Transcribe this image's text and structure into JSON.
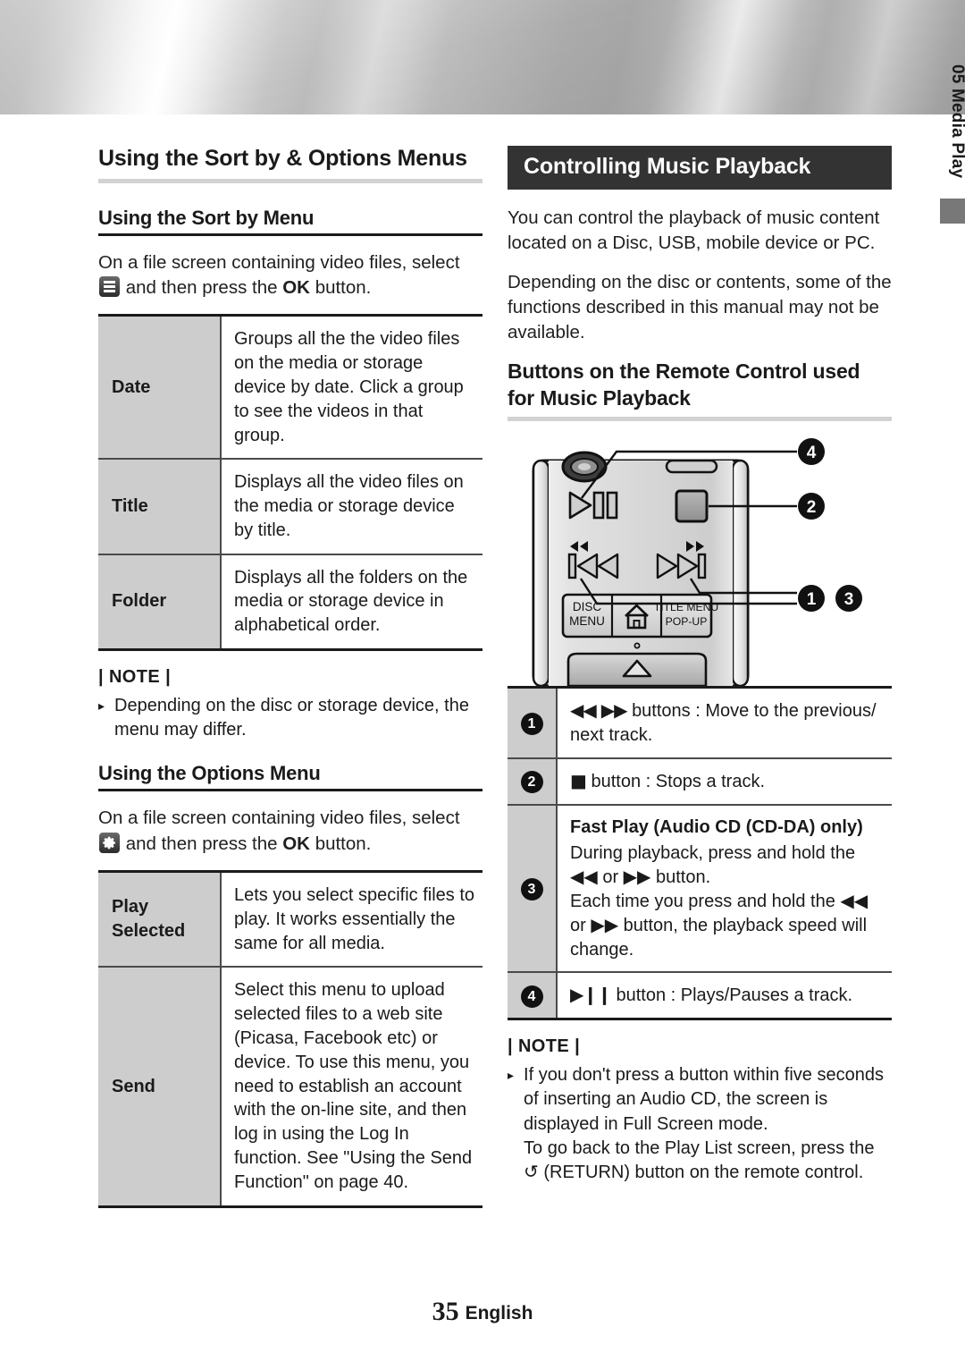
{
  "chapter_tab": {
    "label": "05  Media Play"
  },
  "left": {
    "section_title": "Using the Sort by & Options Menus",
    "sort_by": {
      "heading": "Using the Sort by Menu",
      "intro_a": "On a file screen containing video files, select",
      "intro_b": "and then press the",
      "intro_ok": "OK",
      "intro_c": "button.",
      "rows": [
        {
          "label": "Date",
          "desc": "Groups all the the video files on the media or storage device by date. Click a group to see the videos in that group."
        },
        {
          "label": "Title",
          "desc": "Displays all the video files on the media or storage device by title."
        },
        {
          "label": "Folder",
          "desc": "Displays all the folders on the media or storage device in alphabetical order."
        }
      ],
      "note_head": "| NOTE |",
      "note_items": [
        "Depending on the disc or storage device, the menu may differ."
      ]
    },
    "options": {
      "heading": "Using the Options Menu",
      "intro_a": "On a file screen containing video files, select",
      "intro_b": "and then press the",
      "intro_ok": "OK",
      "intro_c": "button.",
      "rows": [
        {
          "label": "Play Selected",
          "desc": "Lets you select specific files to play. It works essentially the same for all media."
        },
        {
          "label": "Send",
          "desc": "Select this menu to upload selected files to a web site (Picasa, Facebook etc) or device. To use this menu, you need to establish an account with the on-line site, and then log in using the Log In function. See \"Using the Send Function\" on page 40."
        }
      ]
    }
  },
  "right": {
    "banner_title": "Controlling Music Playback",
    "intro_p1": "You can control the playback of music content located on a Disc, USB, mobile device or PC.",
    "intro_p2": "Depending on the disc or contents, some of the functions described in this manual may not be available.",
    "buttons_heading": "Buttons on the Remote Control used for Music Playback",
    "remote": {
      "disc_menu_line1": "DISC",
      "disc_menu_line2": "MENU",
      "home_icon": "home-icon",
      "title_menu_line1": "TITLE MENU",
      "title_menu_line2": "POP-UP",
      "callouts": [
        "1",
        "2",
        "3",
        "4"
      ]
    },
    "rows": [
      {
        "num": "1",
        "glyph": "◀◀  ▶▶",
        "text": "buttons : Move to the previous/ next track."
      },
      {
        "num": "2",
        "glyph": "■",
        "text": "button : Stops a track."
      },
      {
        "num": "3",
        "title": "Fast Play (Audio CD (CD-DA) only)",
        "text": "During playback, press and hold the ◀◀ or ▶▶ button.\nEach time you press and hold the ◀◀ or ▶▶ button, the playback speed will change."
      },
      {
        "num": "4",
        "glyph": "▶❙❙",
        "text": "button : Plays/Pauses a track."
      }
    ],
    "note_head": "| NOTE |",
    "note_items": [
      "If you don't press a button within five seconds of inserting an Audio CD, the screen is displayed in Full Screen mode.\nTo go back to the Play List screen, press the ↺ (RETURN) button on the remote control."
    ]
  },
  "footer": {
    "page_number": "35",
    "language": "English"
  },
  "colors": {
    "header_bar": "#333333",
    "cell_gray": "#cdcdcd",
    "rule_light": "#d2d2d2",
    "text": "#1a1a1a",
    "tab_block": "#787878"
  }
}
